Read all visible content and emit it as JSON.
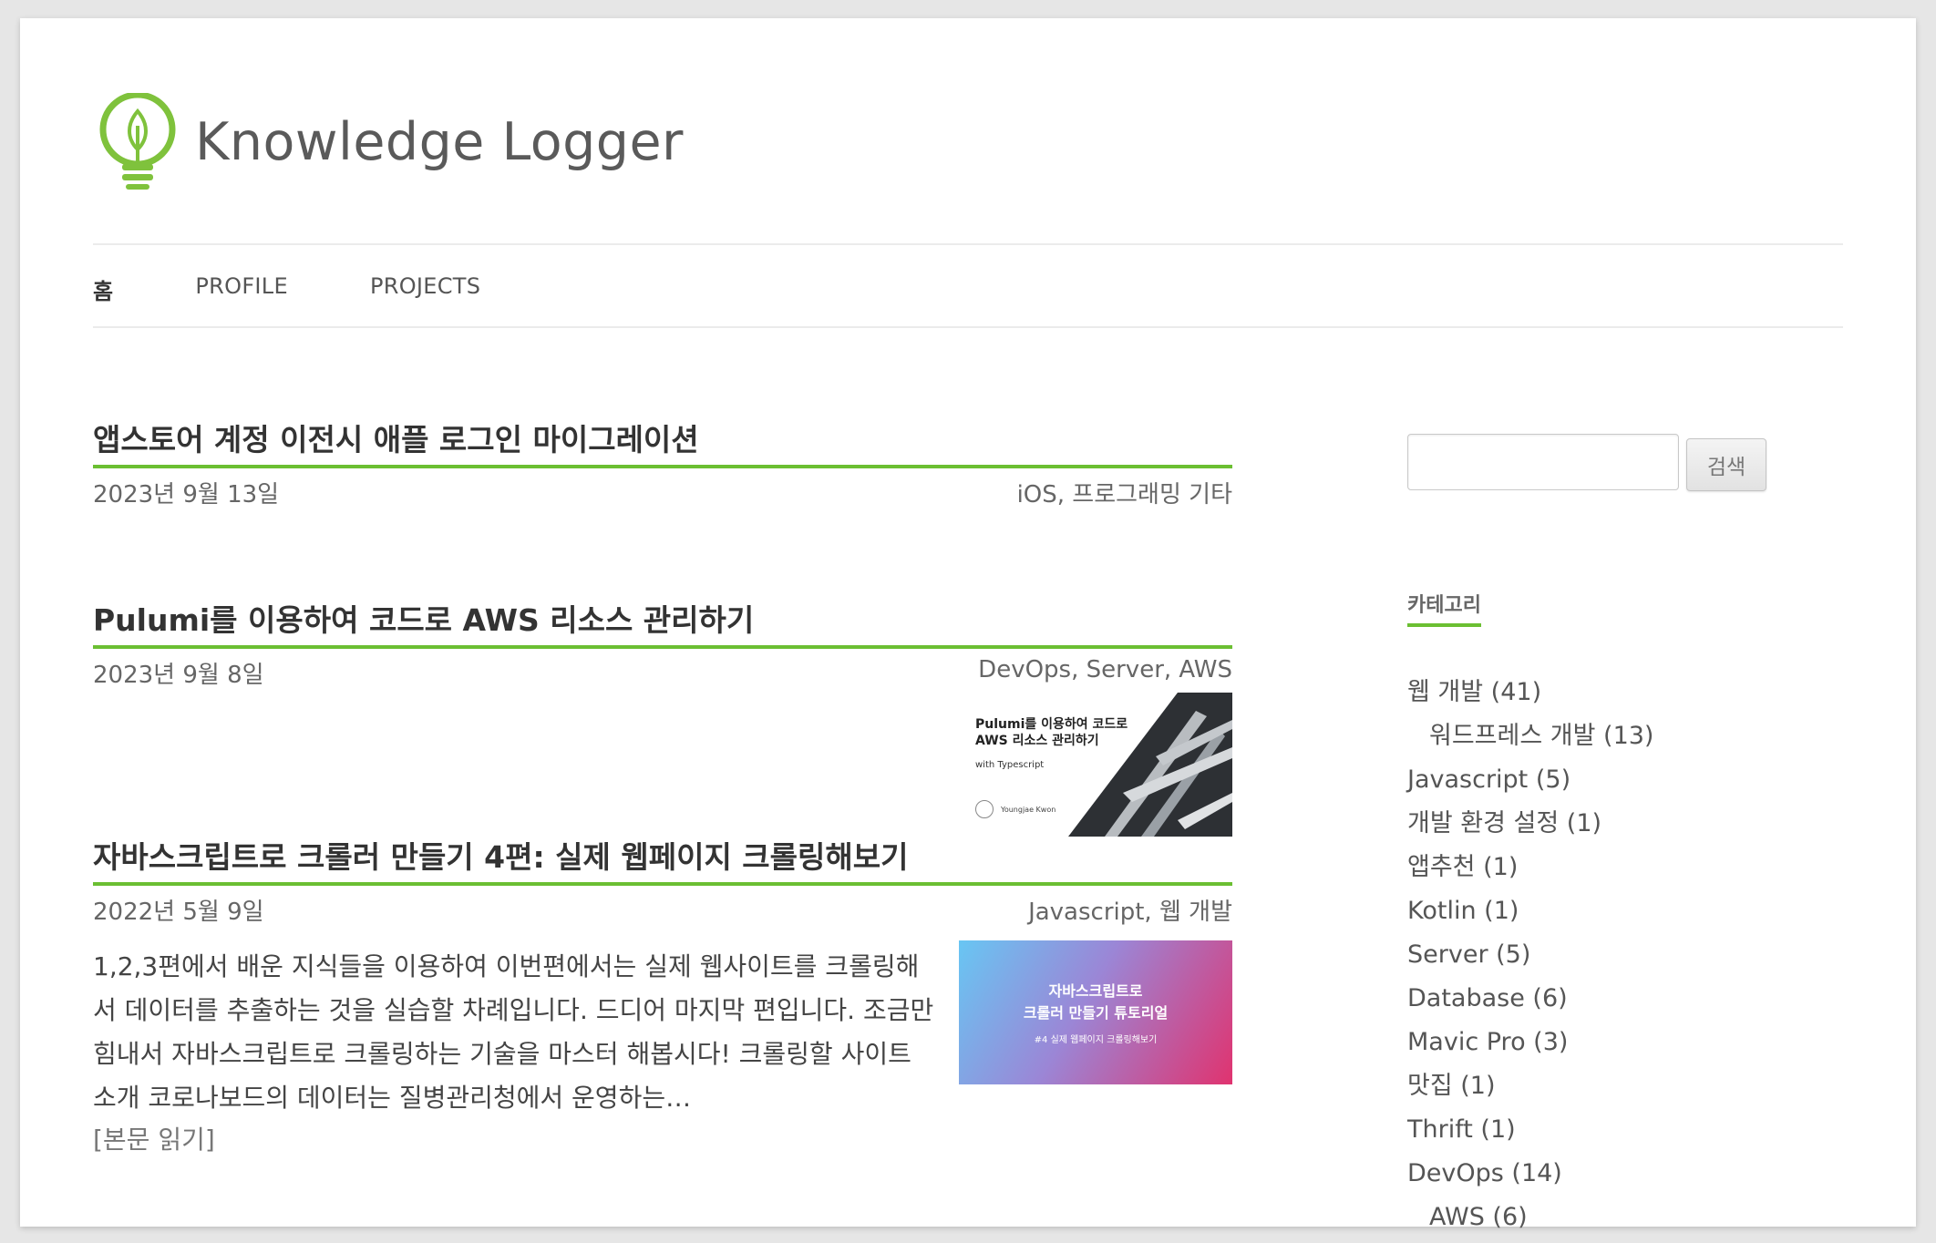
{
  "site": {
    "title": "Knowledge Logger"
  },
  "nav": {
    "items": [
      "홈",
      "PROFILE",
      "PROJECTS"
    ]
  },
  "posts": [
    {
      "title": "앱스토어 계정 이전시 애플 로그인 마이그레이션",
      "date": "2023년 9월 13일",
      "categories": "iOS, 프로그래밍 기타"
    },
    {
      "title": "Pulumi를 이용하여 코드로 AWS 리소스 관리하기",
      "date": "2023년 9월 8일",
      "categories": "DevOps, Server, AWS",
      "thumbnail": {
        "line1": "Pulumi를 이용하여 코드로",
        "line2": "AWS 리소스 관리하기",
        "line3": "with Typescript",
        "author": "Youngjae Kwon"
      }
    },
    {
      "title": "자바스크립트로 크롤러 만들기 4편: 실제 웹페이지 크롤링해보기",
      "date": "2022년 5월 9일",
      "categories": "Javascript, 웹 개발",
      "excerpt": "1,2,3편에서 배운 지식들을 이용하여 이번편에서는 실제 웹사이트를 크롤링해서 데이터를 추출하는 것을 실습할 차례입니다. 드디어 마지막 편입니다. 조금만 힘내서 자바스크립트로 크롤링하는 기술을 마스터 해봅시다! 크롤링할 사이트 소개 코로나보드의 데이터는 질병관리청에서 운영하는…",
      "read_more": "[본문 읽기]",
      "thumbnail": {
        "line1": "자바스크립트로",
        "line2": "크롤러 만들기 튜토리얼",
        "line3": "#4 실제 웹페이지 크롤링해보기"
      }
    }
  ],
  "sidebar": {
    "search_button": "검색",
    "search_placeholder": "",
    "categories_title": "카테고리",
    "categories": [
      {
        "label": "웹 개발 (41)",
        "child": false
      },
      {
        "label": "워드프레스 개발 (13)",
        "child": true
      },
      {
        "label": "Javascript (5)",
        "child": false
      },
      {
        "label": "개발 환경 설정 (1)",
        "child": false
      },
      {
        "label": "앱추천 (1)",
        "child": false
      },
      {
        "label": "Kotlin (1)",
        "child": false
      },
      {
        "label": "Server (5)",
        "child": false
      },
      {
        "label": "Database (6)",
        "child": false
      },
      {
        "label": "Mavic Pro (3)",
        "child": false
      },
      {
        "label": "맛집 (1)",
        "child": false
      },
      {
        "label": "Thrift (1)",
        "child": false
      },
      {
        "label": "DevOps (14)",
        "child": false
      },
      {
        "label": "AWS (6)",
        "child": true
      }
    ]
  },
  "colors": {
    "accent": "#6bbf32",
    "page_bg": "#ffffff",
    "outer_bg": "#e6e6e6"
  }
}
